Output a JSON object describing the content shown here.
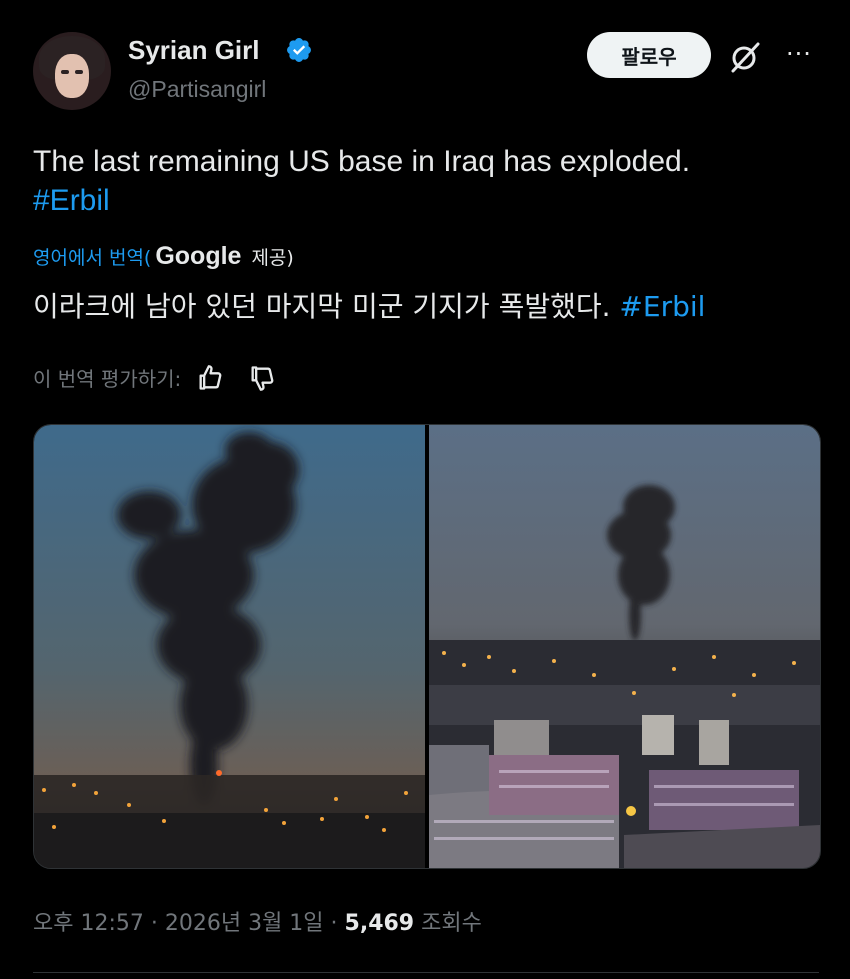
{
  "author": {
    "name": "Syrian Girl",
    "handle": "@Partisangirl"
  },
  "follow_label": "팔로우",
  "more_label": "···",
  "post": {
    "text": "The last remaining US base in Iraq has exploded.",
    "hashtag": "#Erbil"
  },
  "translation": {
    "link": "영어에서 번역(",
    "provider": "Google",
    "provided": "제공)",
    "text": "이라크에 남아 있던 마지막 미군 기지가 폭발했다.",
    "hashtag": "#Erbil",
    "rate_label": "이 번역 평가하기:"
  },
  "meta": {
    "time": "오후 12:57 · 2026년 3월 1일 · ",
    "views": "5,469",
    "views_label": " 조회수"
  },
  "colors": {
    "accent": "#1d9bf0",
    "background": "#000000",
    "secondary_text": "#71767b"
  },
  "icons": [
    "verified-badge-icon",
    "grok-icon",
    "more-icon",
    "thumbs-up-icon",
    "thumbs-down-icon"
  ]
}
